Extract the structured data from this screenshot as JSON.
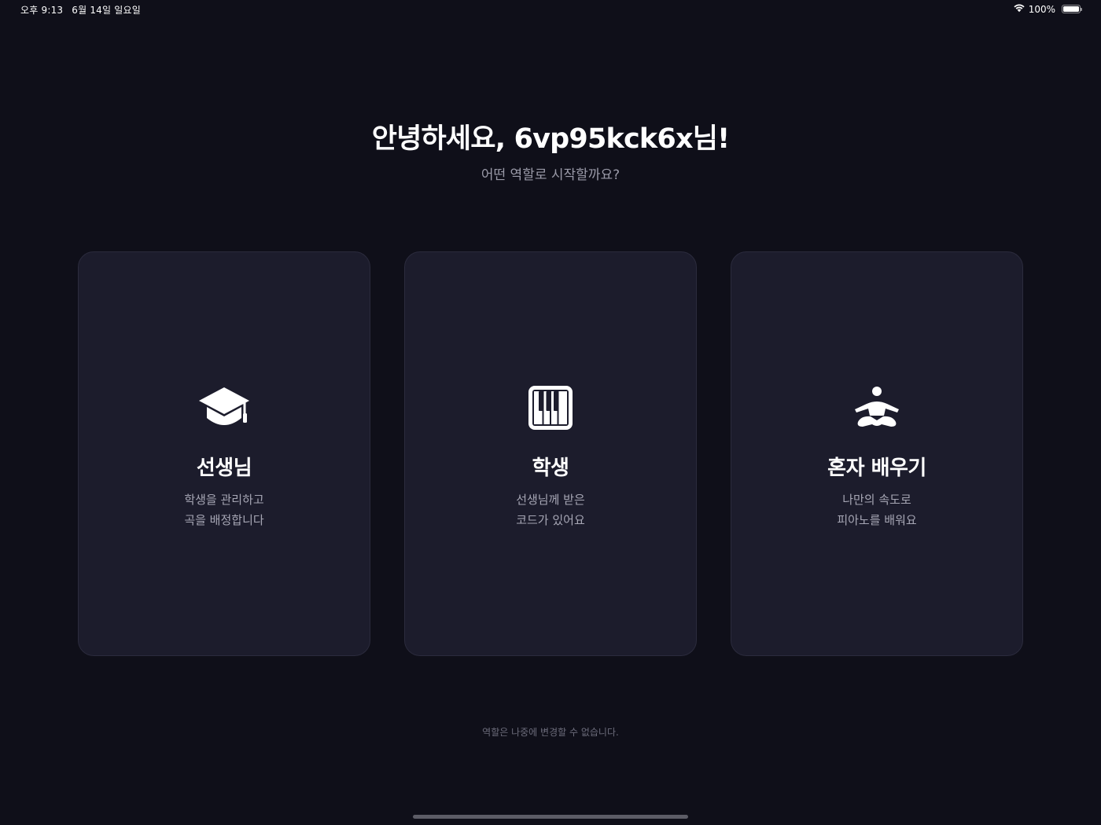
{
  "status_bar": {
    "time": "오후 9:13",
    "date": "6월 14일 일요일",
    "wifi_icon": "wifi-icon",
    "battery_percent": "100%",
    "battery_level": 1.0
  },
  "header": {
    "greeting": "안녕하세요, 6vp95kck6x님!",
    "subtitle": "어떤 역할로 시작할까요?"
  },
  "roles": [
    {
      "icon": "graduation-cap-icon",
      "title": "선생님",
      "desc_line1": "학생을 관리하고",
      "desc_line2": "곡을 배정합니다"
    },
    {
      "icon": "piano-icon",
      "title": "학생",
      "desc_line1": "선생님께 받은",
      "desc_line2": "코드가 있어요"
    },
    {
      "icon": "meditation-person-icon",
      "title": "혼자 배우기",
      "desc_line1": "나만의 속도로",
      "desc_line2": "피아노를 배워요"
    }
  ],
  "footnote": "역할은 나중에 변경할 수 없습니다.",
  "colors": {
    "background": "#0f0f19",
    "card": "#1c1c2c",
    "card_border": "#2b2b3d",
    "text_primary": "#ffffff",
    "text_secondary": "#a6a6b4"
  }
}
